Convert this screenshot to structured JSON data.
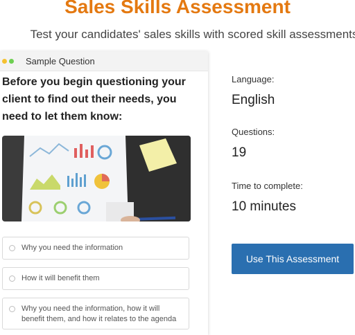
{
  "header": {
    "title": "Sales Skills Assessment",
    "subtitle": "Test your candidates' sales skills with scored skill assessments"
  },
  "card": {
    "label": "Sample Question",
    "question": "Before you begin questioning your client to find out their needs, you need to let them know:",
    "options": [
      "Why you need the information",
      "How it will benefit them",
      "Why you need the information, how it will benefit them, and how it relates to the agenda"
    ]
  },
  "details": {
    "language_label": "Language:",
    "language_value": "English",
    "questions_label": "Questions:",
    "questions_value": "19",
    "time_label": "Time to complete:",
    "time_value": "10 minutes"
  },
  "cta": {
    "label": "Use This Assessment"
  },
  "colors": {
    "title": "#e47911",
    "button": "#2a6fb0"
  }
}
